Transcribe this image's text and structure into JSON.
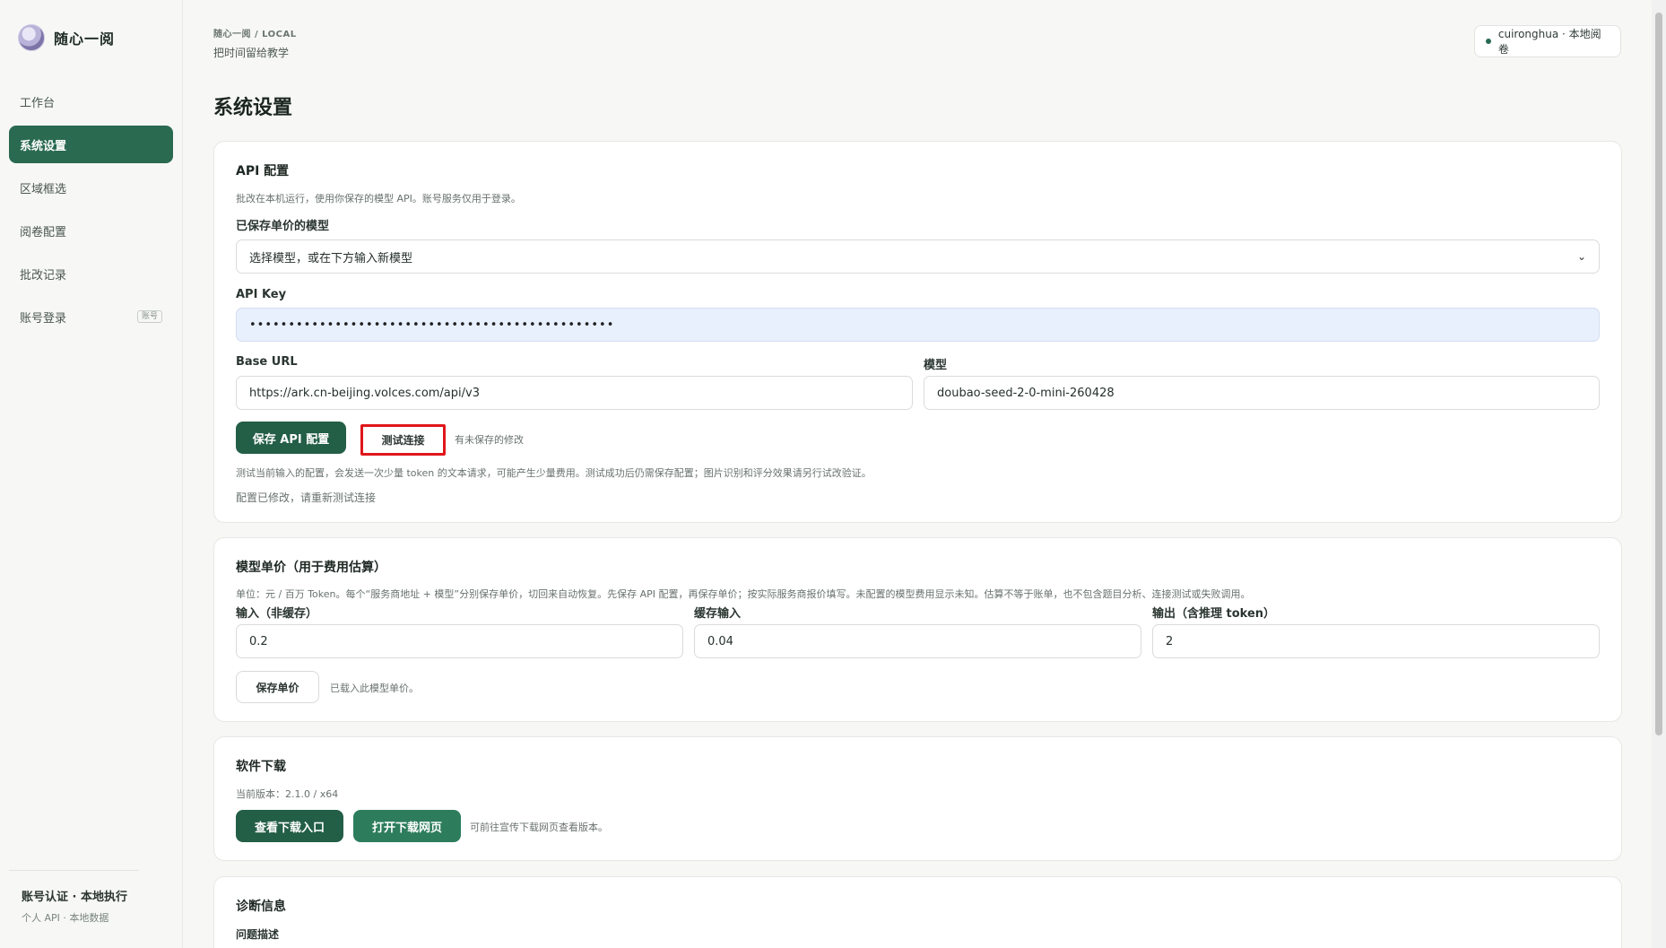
{
  "app": {
    "name": "随心一阅"
  },
  "sidebar": {
    "items": [
      {
        "label": "工作台",
        "active": false
      },
      {
        "label": "系统设置",
        "active": true
      },
      {
        "label": "区域框选",
        "active": false
      },
      {
        "label": "阅卷配置",
        "active": false
      },
      {
        "label": "批改记录",
        "active": false
      },
      {
        "label": "账号登录",
        "active": false,
        "badge": "账号"
      }
    ],
    "footer": {
      "title": "账号认证 · 本地执行",
      "subtitle": "个人 API · 本地数据"
    }
  },
  "header": {
    "breadcrumb": "随心一阅 / LOCAL",
    "subtitle": "把时间留给教学",
    "user": "cuironghua · 本地阅卷"
  },
  "page": {
    "title": "系统设置"
  },
  "api_card": {
    "title": "API 配置",
    "desc": "批改在本机运行，使用你保存的模型 API。账号服务仅用于登录。",
    "saved_model_label": "已保存单价的模型",
    "saved_model_value": "选择模型，或在下方输入新模型",
    "api_key_label": "API Key",
    "api_key_value": "•••••••••••••••••••••••••••••••••••••••••••••••",
    "base_url_label": "Base URL",
    "base_url_value": "https://ark.cn-beijing.volces.com/api/v3",
    "model_label": "模型",
    "model_value": "doubao-seed-2-0-mini-260428",
    "save_button": "保存 API 配置",
    "test_button": "测试连接",
    "unsaved": "有未保存的修改",
    "test_hint": "测试当前输入的配置，会发送一次少量 token 的文本请求，可能产生少量费用。测试成功后仍需保存配置；图片识别和评分效果请另行试改验证。",
    "changed_hint": "配置已修改，请重新测试连接"
  },
  "price_card": {
    "title": "模型单价（用于费用估算）",
    "desc": "单位：元 / 百万 Token。每个“服务商地址 + 模型”分别保存单价，切回来自动恢复。先保存 API 配置，再保存单价；按实际服务商报价填写。未配置的模型费用显示未知。估算不等于账单，也不包含题目分析、连接测试或失败调用。",
    "input_label": "输入（非缓存）",
    "input_value": "0.2",
    "cached_label": "缓存输入",
    "cached_value": "0.04",
    "output_label": "输出（含推理 token）",
    "output_value": "2",
    "save_button": "保存单价",
    "status": "已载入此模型单价。"
  },
  "download_card": {
    "title": "软件下载",
    "version": "当前版本：2.1.0 / x64",
    "view_button": "查看下载入口",
    "open_button": "打开下载网页",
    "hint": "可前往宣传下载网页查看版本。"
  },
  "diag_card": {
    "title": "诊断信息",
    "problem_label": "问题描述"
  }
}
